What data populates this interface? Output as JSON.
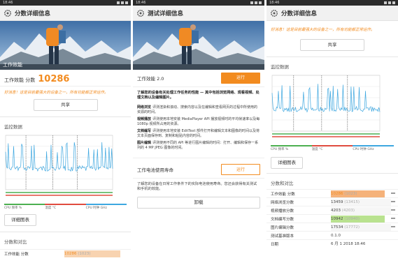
{
  "panel1": {
    "status_time": "18:46",
    "app_title": "分数详细信息",
    "hero_overlay": "工作效能",
    "score_label": "工作效能 分数",
    "score_value": "10286",
    "message": "好消息！这是目前最强大的设备之一，所有功能都正常运作。",
    "share_label": "共享",
    "monitoring_title": "监控数据",
    "legend": [
      {
        "label": "CPU 频率 %",
        "color": "#4caf50"
      },
      {
        "label": "温度 °C",
        "color": "#e04b3f"
      },
      {
        "label": "CPU 时钟 GHz",
        "color": "#3da7e0"
      }
    ],
    "detail_chart_label": "详细图表",
    "compare_title": "分数和对比",
    "compare_row_name": "工作效能 分数",
    "compare_row_value": "10286",
    "compare_row_paren": "(1023)"
  },
  "panel2": {
    "status_time": "18:46",
    "app_title": "测试详细信息",
    "hero_overlay": "",
    "perf_label": "工作效能 2.0",
    "run_label": "运行",
    "intro": "了解您的设备有关处理工作任务的性能 — 其中包括浏览网络、观看视频、处理文档以及编辑图片。",
    "items": [
      {
        "key": "网络浏览",
        "text": "评测渲染和滚动、搜索内容以及在编辑和查看网页的过程中所使用的资源的时间。"
      },
      {
        "key": "视频播放",
        "text": "评测使用本地安装 MediaPlayer API 播放视频时的平均帧速率以及每 1080p 视频所占用的资源。"
      },
      {
        "key": "文档编写",
        "text": "评测使用本地安装 EditText 部件打开和编辑文本和图像的时间以及将文本页面保存到、复制和粘贴内容的时间。"
      },
      {
        "key": "图片编辑",
        "text": "评测使用不同的 API 等进行图片编辑的时间：打开、编辑和保存一系列的 4 MP JPEG 图像的时间。"
      }
    ],
    "battery_label": "工作电池使用寿命",
    "battery_run_label": "运行",
    "battery_desc": "了解您的设备在日常工作条件下的实际电池使用寿命。您还会获得有关测试和手机的效能。",
    "uninstall_label": "卸载"
  },
  "panel3": {
    "status_time": "18:46",
    "app_title": "分数详细信息",
    "message": "好消息！这是目前最强大的设备之一，所有功能都正常运作。",
    "share_label": "共享",
    "monitoring_title": "监控数据",
    "legend": [
      {
        "label": "CPU 频率 %",
        "color": "#4caf50"
      },
      {
        "label": "温度 °C",
        "color": "#e04b3f"
      },
      {
        "label": "CPU 时钟 GHz",
        "color": "#3da7e0"
      }
    ],
    "detail_chart_label": "详细图表",
    "compare_title": "分数和对比",
    "rows": [
      {
        "name": "工作效能 分数",
        "value": "10286",
        "paren": "(1023)",
        "highlight": "#f5b27a",
        "bar": 0.9
      },
      {
        "name": "网络浏览分数",
        "value": "13459",
        "paren": "(13415)",
        "highlight": "#f6f6f6",
        "bar": 0.0
      },
      {
        "name": "视频播放分数",
        "value": "4203",
        "paren": "(4203)",
        "highlight": "#f6f6f6",
        "bar": 0.0
      },
      {
        "name": "文档编写分数",
        "value": "10942",
        "paren": "(10940)",
        "highlight": "#b9e28f",
        "bar": 0.9
      },
      {
        "name": "图片编辑分数",
        "value": "17534",
        "paren": "(17772)",
        "highlight": "#f6f6f6",
        "bar": 0.0
      },
      {
        "name": "测试基准版本",
        "value": "0.1.0",
        "paren": "",
        "highlight": "",
        "bar": 0.0
      },
      {
        "name": "日期",
        "value": "6 月 1 2018 18:46",
        "paren": "",
        "highlight": "",
        "bar": 0.0
      }
    ]
  },
  "colors": {
    "accent": "#f28b1f",
    "line_blue": "#3da7e0",
    "grid": "#e4e4e4"
  }
}
